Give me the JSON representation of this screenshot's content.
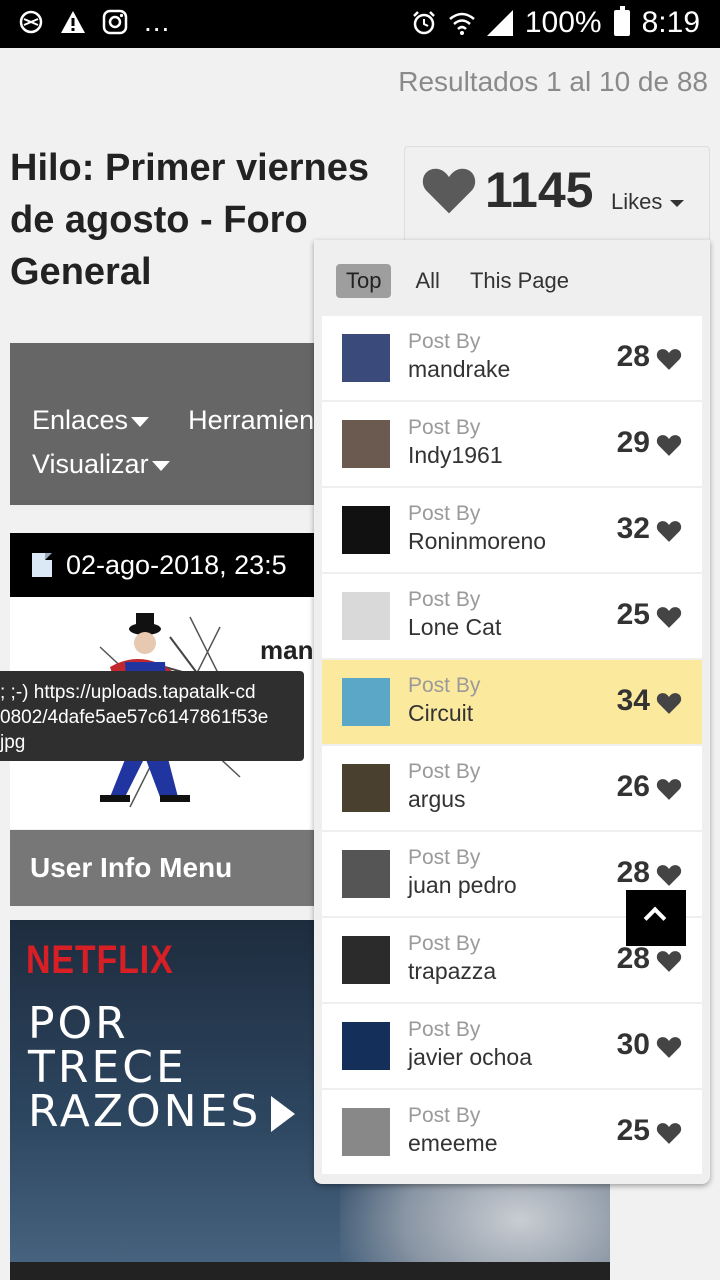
{
  "status_bar": {
    "battery_pct": "100%",
    "time": "8:19",
    "overflow": "..."
  },
  "page": {
    "results_text": "Resultados 1 al 10 de 88",
    "thread_title": "Hilo: Primer viernes de agosto - Foro General",
    "menu": {
      "links_label": "Enlaces",
      "tools_label": "Herramient",
      "view_label": "Visualizar"
    },
    "post_date": "02-ago-2018,   23:5",
    "username_peek": "man",
    "tooltip_lines": [
      "; ;-) https://uploads.tapatalk-cd",
      "0802/4dafe5ae57c6147861f53e",
      "jpg"
    ],
    "user_info_menu": "User Info Menu",
    "banner": {
      "brand": "NETFLIX",
      "title_lines": [
        "POR",
        "TRECE",
        "RAZONES"
      ]
    }
  },
  "likes": {
    "count": "1145",
    "label": "Likes",
    "tabs": [
      "Top",
      "All",
      "This Page"
    ],
    "active_tab": "Top",
    "post_by_label": "Post By",
    "entries": [
      {
        "user": "mandrake",
        "likes": "28",
        "highlight": false,
        "thumb": "#3a4a7a"
      },
      {
        "user": "Indy1961",
        "likes": "29",
        "highlight": false,
        "thumb": "#6a5a50"
      },
      {
        "user": "Roninmoreno",
        "likes": "32",
        "highlight": false,
        "thumb": "#111111"
      },
      {
        "user": "Lone Cat",
        "likes": "25",
        "highlight": false,
        "thumb": "#d9d9d9"
      },
      {
        "user": "Circuit",
        "likes": "34",
        "highlight": true,
        "thumb": "#5aa7c7"
      },
      {
        "user": "argus",
        "likes": "26",
        "highlight": false,
        "thumb": "#4a4030"
      },
      {
        "user": "juan pedro",
        "likes": "28",
        "highlight": false,
        "thumb": "#555555"
      },
      {
        "user": "trapazza",
        "likes": "28",
        "highlight": false,
        "thumb": "#2b2b2b"
      },
      {
        "user": "javier ochoa",
        "likes": "30",
        "highlight": false,
        "thumb": "#14305a"
      },
      {
        "user": "emeeme",
        "likes": "25",
        "highlight": false,
        "thumb": "#888888"
      }
    ],
    "highlight_color": "#fbe99e"
  },
  "icons": {
    "heart": "heart-icon",
    "back_to_top": "chevron-up-icon"
  }
}
